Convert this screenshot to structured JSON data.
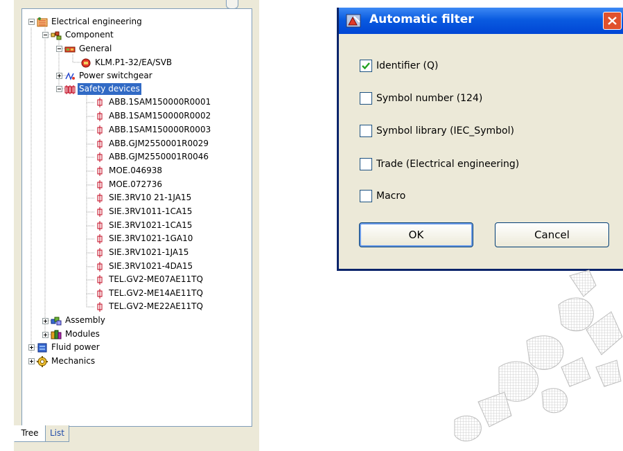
{
  "tree": {
    "nodes": [
      {
        "label": "Electrical engineering",
        "icon": "electrical-engineering-icon"
      },
      {
        "label": "Component",
        "icon": "component-icon"
      },
      {
        "label": "General",
        "icon": "general-icon"
      },
      {
        "label": "KLM.P1-32/EA/SVB",
        "icon": "device-icon"
      },
      {
        "label": "Power switchgear",
        "icon": "power-switchgear-icon"
      },
      {
        "label": "Safety devices",
        "icon": "safety-devices-icon"
      },
      {
        "label": "ABB.1SAM150000R0001",
        "icon": "fuse-icon"
      },
      {
        "label": "ABB.1SAM150000R0002",
        "icon": "fuse-icon"
      },
      {
        "label": "ABB.1SAM150000R0003",
        "icon": "fuse-icon"
      },
      {
        "label": "ABB.GJM2550001R0029",
        "icon": "fuse-icon"
      },
      {
        "label": "ABB.GJM2550001R0046",
        "icon": "fuse-icon"
      },
      {
        "label": "MOE.046938",
        "icon": "fuse-icon"
      },
      {
        "label": "MOE.072736",
        "icon": "fuse-icon"
      },
      {
        "label": "SIE.3RV10 21-1JA15",
        "icon": "fuse-icon"
      },
      {
        "label": "SIE.3RV1011-1CA15",
        "icon": "fuse-icon"
      },
      {
        "label": "SIE.3RV1021-1CA15",
        "icon": "fuse-icon"
      },
      {
        "label": "SIE.3RV1021-1GA10",
        "icon": "fuse-icon"
      },
      {
        "label": "SIE.3RV1021-1JA15",
        "icon": "fuse-icon"
      },
      {
        "label": "SIE.3RV1021-4DA15",
        "icon": "fuse-icon"
      },
      {
        "label": "TEL.GV2-ME07AE11TQ",
        "icon": "fuse-icon"
      },
      {
        "label": "TEL.GV2-ME14AE11TQ",
        "icon": "fuse-icon"
      },
      {
        "label": "TEL.GV2-ME22AE11TQ",
        "icon": "fuse-icon"
      },
      {
        "label": "Assembly",
        "icon": "assembly-icon"
      },
      {
        "label": "Modules",
        "icon": "modules-icon"
      },
      {
        "label": "Fluid power",
        "icon": "fluid-power-icon"
      },
      {
        "label": "Mechanics",
        "icon": "mechanics-icon"
      }
    ],
    "selected_label": "Safety devices",
    "tabs": {
      "tree": "Tree",
      "list": "List"
    }
  },
  "dialog": {
    "title": "Automatic filter",
    "options": [
      {
        "label": "Identifier (Q)",
        "checked": true
      },
      {
        "label": "Symbol number (124)",
        "checked": false
      },
      {
        "label": "Symbol library (IEC_Symbol)",
        "checked": false
      },
      {
        "label": "Trade (Electrical engineering)",
        "checked": false
      },
      {
        "label": "Macro",
        "checked": false
      }
    ],
    "ok_label": "OK",
    "cancel_label": "Cancel"
  },
  "colors": {
    "titlebar": "#0a5be0",
    "selection": "#316ac5",
    "close": "#e0512d",
    "check": "#21a121"
  }
}
